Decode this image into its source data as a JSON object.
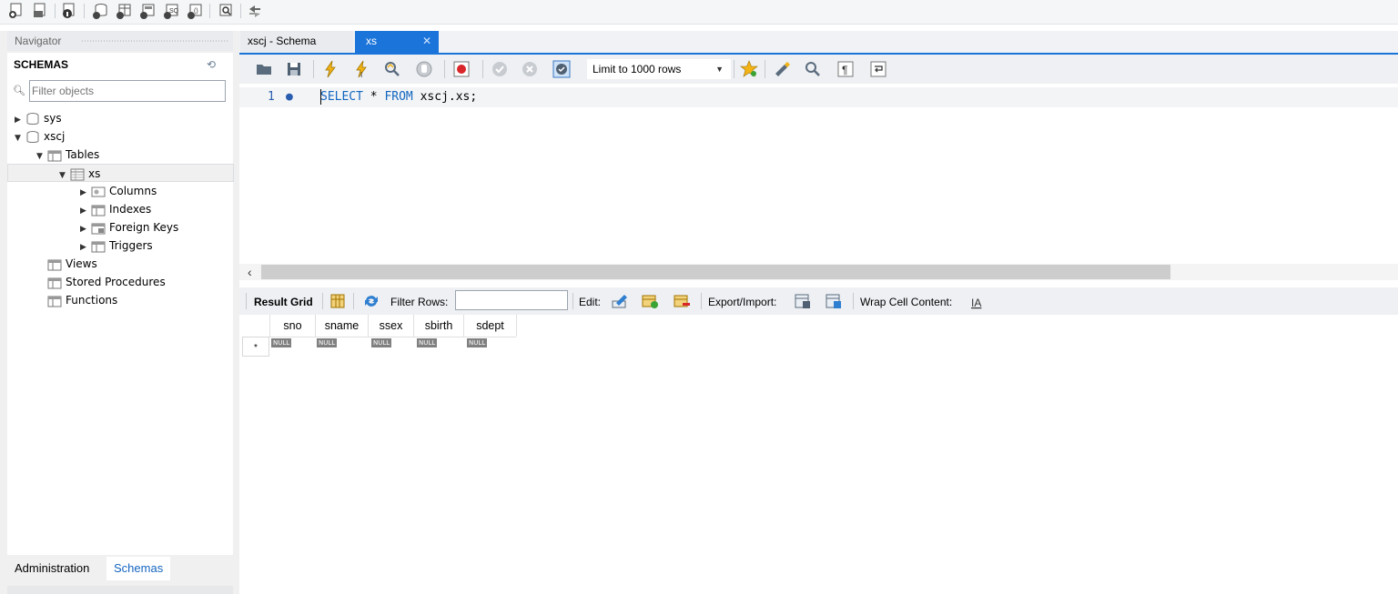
{
  "navigator": {
    "header": "Navigator",
    "schemas_title": "SCHEMAS",
    "filter_placeholder": "Filter objects",
    "tree": {
      "sys": "sys",
      "xscj": "xscj",
      "tables": "Tables",
      "xs": "xs",
      "columns": "Columns",
      "indexes": "Indexes",
      "foreign_keys": "Foreign Keys",
      "triggers": "Triggers",
      "views": "Views",
      "stored_procedures": "Stored Procedures",
      "functions": "Functions"
    },
    "bottom_tabs": {
      "administration": "Administration",
      "schemas": "Schemas"
    }
  },
  "editor": {
    "tabs": {
      "schema": "xscj - Schema",
      "xs": "xs"
    },
    "limit": "Limit to 1000 rows",
    "line_number": "1",
    "sql": {
      "kw1": "SELECT",
      "rest1": " * ",
      "kw2": "FROM",
      "rest2": " xscj.xs;"
    }
  },
  "result": {
    "result_grid": "Result Grid",
    "filter_rows": "Filter Rows:",
    "edit": "Edit:",
    "export_import": "Export/Import:",
    "wrap_cell": "Wrap Cell Content:",
    "columns": [
      "sno",
      "sname",
      "ssex",
      "sbirth",
      "sdept"
    ],
    "null_label": "NULL",
    "row_marker": "*"
  },
  "colors": {
    "accent": "#1b74d9",
    "keyword": "#1466c0",
    "null_bg": "#808080"
  },
  "icons": [
    "new-sql-tab-icon",
    "open-sql-file-icon",
    "info-icon",
    "create-schema-icon",
    "create-table-icon",
    "create-view-icon",
    "create-procedure-icon",
    "create-function-icon",
    "search-table-icon",
    "reconnect-icon",
    "folder-icon",
    "save-icon",
    "execute-icon",
    "execute-current-icon",
    "explain-icon",
    "stop-icon",
    "toggle-error-icon",
    "commit-icon",
    "rollback-icon",
    "autocommit-icon",
    "bookmark-icon",
    "beautify-icon",
    "find-icon",
    "invisible-chars-icon",
    "wrap-icon"
  ]
}
